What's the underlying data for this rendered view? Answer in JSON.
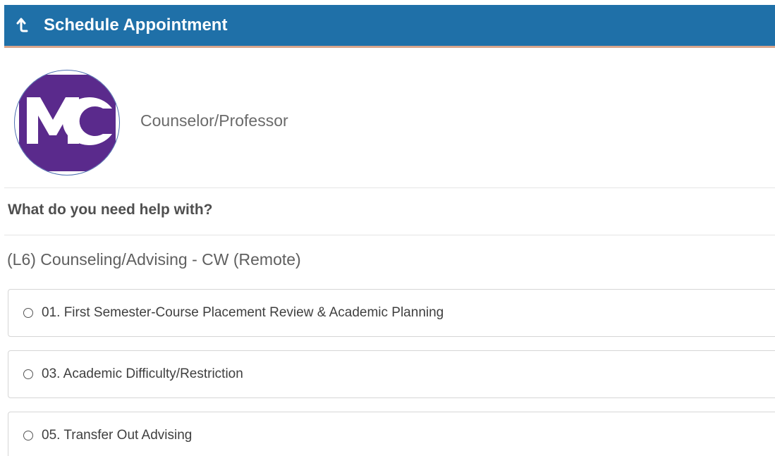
{
  "header": {
    "title": "Schedule Appointment",
    "back_icon": "back-arrow-up-icon",
    "background_color": "#1f70a8",
    "accent_border_color": "#d9a68c"
  },
  "profile": {
    "logo_text": "MC",
    "logo_color": "#5a2a8c",
    "label": "Counselor/Professor"
  },
  "question": {
    "text": "What do you need help with?"
  },
  "location": {
    "label": "(L6) Counseling/Advising - CW (Remote)"
  },
  "options": [
    {
      "label": "01. First Semester-Course Placement Review & Academic Planning",
      "selected": false
    },
    {
      "label": "03. Academic Difficulty/Restriction",
      "selected": false
    },
    {
      "label": "05. Transfer Out Advising",
      "selected": false
    }
  ]
}
